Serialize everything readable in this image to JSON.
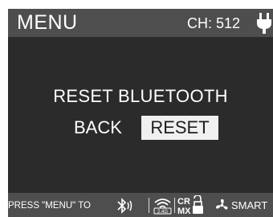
{
  "header": {
    "title": "MENU",
    "channel": "CH: 512",
    "power_icon": "plug-icon"
  },
  "main": {
    "prompt": "RESET BLUETOOTH",
    "options": [
      {
        "label": "BACK",
        "selected": false
      },
      {
        "label": "RESET",
        "selected": true
      }
    ]
  },
  "footer": {
    "hint": "PRESS \"MENU\" TO",
    "status_icons": [
      "bluetooth-icon",
      "wifi-2.4g-icon",
      "crmx-icon",
      "lock-icon",
      "fan-icon"
    ],
    "wifi_badge": "2.4G",
    "crmx_label_top": "CR",
    "crmx_label_bottom": "MX",
    "fan_mode": "SMART"
  },
  "colors": {
    "header_bg": "#4e4e4e",
    "screen_bg": "#2b2b2b",
    "selected_bg": "#f0f0f0",
    "text": "#ffffff"
  }
}
